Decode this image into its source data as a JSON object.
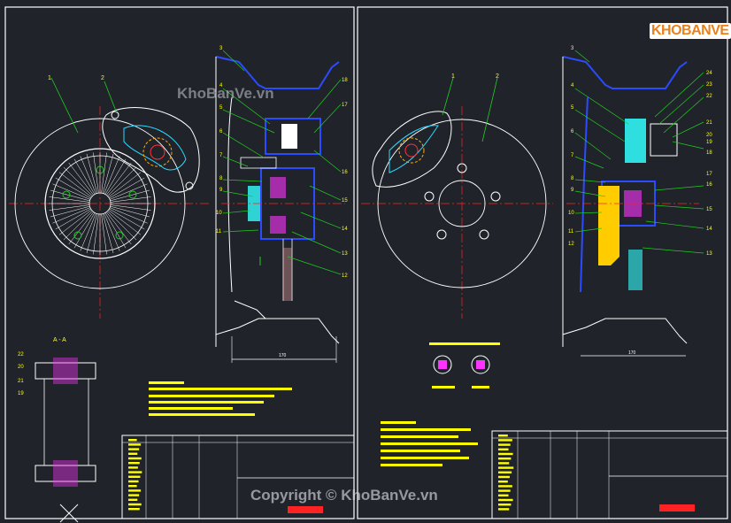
{
  "watermarks": {
    "top": "KhoBanVe.vn",
    "bottom": "Copyright © KhoBanVe.vn"
  },
  "logo": {
    "text": "KHOBANVE"
  },
  "left_sheet": {
    "section_label": "A - A",
    "callouts": [
      "1",
      "2",
      "3",
      "4",
      "5",
      "6",
      "7",
      "8",
      "9",
      "10",
      "11",
      "12",
      "13",
      "14",
      "15",
      "16",
      "17",
      "18"
    ],
    "section_callouts": [
      "19",
      "20",
      "21",
      "22"
    ],
    "dimension": "170"
  },
  "right_sheet": {
    "callouts": [
      "1",
      "2",
      "3",
      "4",
      "5",
      "6",
      "7",
      "8",
      "9",
      "10",
      "11",
      "12",
      "13",
      "14",
      "15",
      "16",
      "17",
      "18",
      "19",
      "20",
      "21",
      "22",
      "23",
      "24"
    ],
    "dimension": "170",
    "legend_items": [
      "",
      ""
    ]
  },
  "colors": {
    "background": "#20242a",
    "frame": "#ffffff",
    "blue": "#2b4bff",
    "yellow": "#ffff00",
    "green": "#22cc22",
    "magenta": "#ff33ff",
    "cyan": "#33ffff",
    "red": "#ff2222"
  }
}
